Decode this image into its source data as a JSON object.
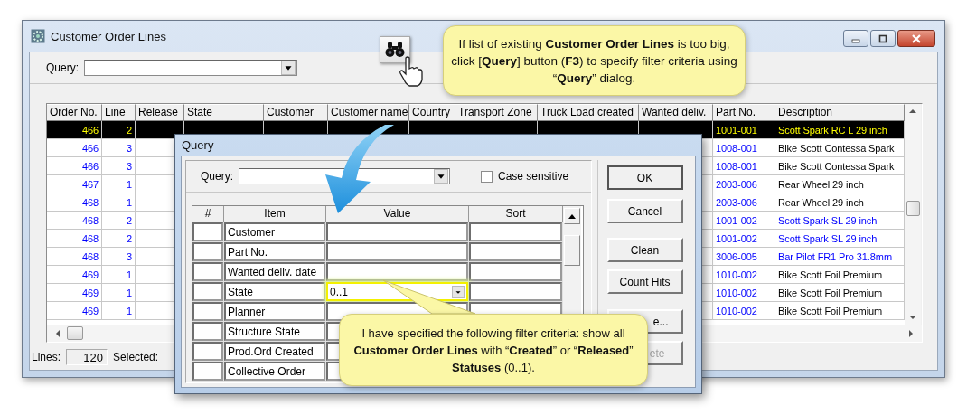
{
  "window": {
    "title": "Customer Order Lines",
    "query_label": "Query:"
  },
  "table": {
    "columns": [
      "Order No.",
      "Line",
      "Release",
      "State",
      "Customer",
      "Customer name",
      "Country",
      "Transport Zone",
      "Truck Load created",
      "Wanted deliv.",
      "Part No.",
      "Description"
    ],
    "rows": [
      {
        "order_no": "466",
        "line": "2",
        "part_no": "1001-001",
        "description": "Scott Spark RC L 29 inch",
        "selected": true
      },
      {
        "order_no": "466",
        "line": "3",
        "part_no": "1008-001",
        "description": "Bike Scott Contessa Spark",
        "color": "#000000",
        "selected": false
      },
      {
        "order_no": "466",
        "line": "3",
        "part_no": "1008-001",
        "description": "Bike Scott Contessa Spark",
        "color": "#000000",
        "selected": false
      },
      {
        "order_no": "467",
        "line": "1",
        "part_no": "2003-006",
        "description": "Rear Wheel 29 inch",
        "color": "#000000",
        "selected": false
      },
      {
        "order_no": "468",
        "line": "1",
        "part_no": "2003-006",
        "description": "Rear Wheel 29 inch",
        "color": "#000000",
        "selected": false
      },
      {
        "order_no": "468",
        "line": "2",
        "part_no": "1001-002",
        "description": "Scott Spark SL 29 inch",
        "color": "#0000ff",
        "selected": false
      },
      {
        "order_no": "468",
        "line": "2",
        "part_no": "1001-002",
        "description": "Scott Spark SL 29 inch",
        "color": "#0000ff",
        "selected": false
      },
      {
        "order_no": "468",
        "line": "3",
        "part_no": "3006-005",
        "description": "Bar Pilot FR1 Pro 31.8mm",
        "color": "#0000ff",
        "selected": false
      },
      {
        "order_no": "469",
        "line": "1",
        "part_no": "1010-002",
        "description": "Bike Scott Foil Premium",
        "color": "#000000",
        "selected": false
      },
      {
        "order_no": "469",
        "line": "1",
        "part_no": "1010-002",
        "description": "Bike Scott Foil Premium",
        "color": "#000000",
        "selected": false
      },
      {
        "order_no": "469",
        "line": "1",
        "part_no": "1010-002",
        "description": "Bike Scott Foil Premium",
        "color": "#000000",
        "selected": false
      }
    ]
  },
  "status_bar": {
    "lines_label": "Lines:",
    "lines_value": "120",
    "selected_label": "Selected:"
  },
  "query_dialog": {
    "title": "Query",
    "query_label": "Query:",
    "case_sensitive": {
      "label": "Case sensitive",
      "checked": false
    },
    "grid": {
      "columns": [
        "#",
        "Item",
        "Value",
        "Sort"
      ],
      "rows": [
        {
          "item": "Customer",
          "highlighted": false
        },
        {
          "item": "Part No.",
          "highlighted": false
        },
        {
          "item": "Wanted deliv. date",
          "highlighted": false
        },
        {
          "item": "State",
          "value": "0..1",
          "highlighted": true
        },
        {
          "item": "Planner",
          "highlighted": false
        },
        {
          "item": "Structure State",
          "highlighted": false
        },
        {
          "item": "Prod.Ord Created",
          "highlighted": false
        },
        {
          "item": "Collective Order",
          "highlighted": false
        }
      ]
    },
    "buttons": [
      {
        "label": "OK",
        "disabled": false
      },
      {
        "label": "Cancel",
        "disabled": false
      },
      {
        "label": "Clean",
        "disabled": false
      },
      {
        "label": "Count Hits",
        "disabled": false
      },
      {
        "label": "e...",
        "disabled": false
      },
      {
        "label": "ete",
        "disabled": true
      }
    ]
  },
  "callouts": [
    {
      "text": "If list of existing **Customer Order Lines** is too big, click [**Query**] button (**F3**) to specify filter criteria using “**Query**” dialog."
    },
    {
      "text": "I have specified the following filter criteria: show all **Customer Order Lines** with “**Created**” or “**Released**” **Statuses** (0..1)."
    }
  ]
}
